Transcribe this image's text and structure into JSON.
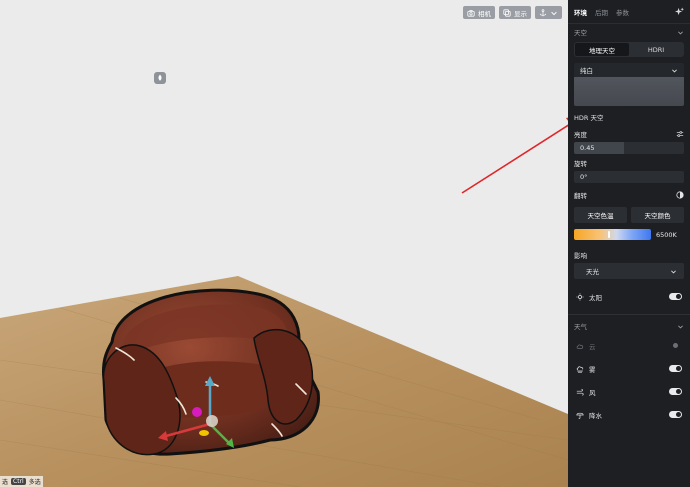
{
  "toolbar": {
    "camera_label": "相机",
    "display_label": "显示"
  },
  "status_hint": {
    "left_text": "选",
    "key": "Ctrl",
    "right_text": "多选"
  },
  "panel": {
    "tabs": [
      {
        "label": "环境",
        "active": true
      },
      {
        "label": "后期",
        "active": false
      },
      {
        "label": "参数",
        "active": false
      }
    ],
    "sky": {
      "section_title": "天空",
      "segments": [
        "地理天空",
        "HDRI"
      ],
      "active_segment": "地理天空",
      "preset": "纯白",
      "hdr_title": "HDR 天空",
      "brightness_label": "亮度",
      "brightness_value": "0.45",
      "brightness_fraction": 0.45,
      "rotation_label": "旋转",
      "rotation_value": "0°",
      "flip_label": "翻转",
      "sky_color_button": "天空色温",
      "sky_tint_button": "天空颜色",
      "color_temperature": "6500K",
      "influence_label": "影响",
      "influence_value": "天光",
      "sun_label": "太阳"
    },
    "weather": {
      "section_title": "天气",
      "items": [
        {
          "label": "云",
          "enabled": false
        },
        {
          "label": "雾",
          "enabled": true
        },
        {
          "label": "风",
          "enabled": true
        },
        {
          "label": "降水",
          "enabled": true
        }
      ]
    }
  },
  "colors": {
    "panel_bg": "#1d1f22",
    "viewport_bg": "#ebebeb",
    "arrow": "#e0262a"
  }
}
